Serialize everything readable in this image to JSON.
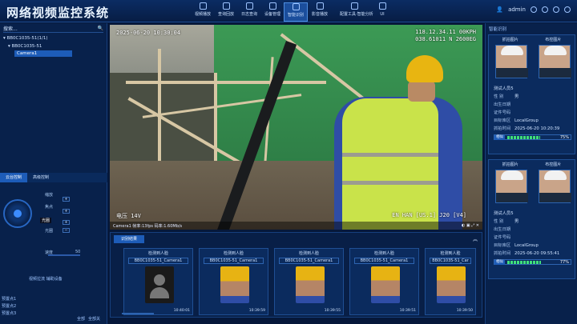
{
  "app": {
    "title": "网络视频监控系统",
    "user": "admin"
  },
  "nav": [
    {
      "label": "视频播放"
    },
    {
      "label": "查询回放"
    },
    {
      "label": "日志查询"
    },
    {
      "label": "设备管理"
    },
    {
      "label": "智能识别",
      "active": true
    },
    {
      "label": "影音播放"
    },
    {
      "label": "配置工具·智能分析"
    },
    {
      "label": "UI"
    }
  ],
  "left": {
    "search_placeholder": "搜索...",
    "tree": [
      {
        "label": "BB0C1035-51(1/1)"
      },
      {
        "label": "BB0C1035-51"
      },
      {
        "label": "Camera1",
        "selected": true
      }
    ],
    "tabs": [
      "云台控制",
      "高级控制"
    ],
    "ptz": {
      "zoom": "缩放",
      "focus": "焦点",
      "iris": "光圈",
      "speed_label": "速度",
      "speed_value": "50",
      "tooltip": "光圈"
    },
    "hint": "视频拉流   辅助设备",
    "presets": [
      "预置点1",
      "预置点2",
      "预置点3"
    ],
    "footer_btns": [
      "全部",
      "全部关"
    ]
  },
  "video": {
    "timestamp": "2025-06-20 10:30:04",
    "osd_tr1": "118.12.34.11 00KPH",
    "osd_tr2": "038.61011 N 2600EG",
    "osd_bl": "电压 14V",
    "osd_br": "EN HAN [US.1] J20 [V4]",
    "status_left": "Camera1  帧率:13fps 码率:1.60Mb/s",
    "status_right": "◐ ▣ ⤢ ✕"
  },
  "bottom": {
    "tab": "识别结果",
    "cards": [
      {
        "header": "检测到人脸",
        "camera": "BB0C1035-51_Camera1",
        "time": "10:40:01",
        "type": "placeholder"
      },
      {
        "header": "检测到人脸",
        "camera": "BB0C1035-51_Camera1",
        "time": "10:39:59",
        "type": "helmet"
      },
      {
        "header": "检测到人脸",
        "camera": "BB0C1035-51_Camera1",
        "time": "10:39:55",
        "type": "helmet"
      },
      {
        "header": "检测到人脸",
        "camera": "BB0C1035-51_Camera1",
        "time": "10:39:51",
        "type": "helmet"
      },
      {
        "header": "检测到人脸",
        "camera": "BB0C1035-51_Car",
        "time": "10:39:50",
        "type": "helmet"
      }
    ]
  },
  "right": {
    "header": "智能识别",
    "records": [
      {
        "snap_label": "抓拍图片",
        "lib_label": "布控图片",
        "name_k": "测试人员5",
        "gender_k": "性    别",
        "gender_v": "男",
        "birth_k": "出生日期",
        "cert_k": "证件号码",
        "lib_k": "目标库区",
        "lib_v": "LocalGroup",
        "time_k": "抓拍时间",
        "time_v": "2025-06-20 10:20:39",
        "sim_tag": "相似",
        "similarity": 75,
        "sim_text": "75%"
      },
      {
        "snap_label": "抓拍图片",
        "lib_label": "布控图片",
        "name_k": "测试人员5",
        "gender_k": "性    别",
        "gender_v": "男",
        "birth_k": "出生日期",
        "cert_k": "证件号码",
        "lib_k": "目标库区",
        "lib_v": "LocalGroup",
        "time_k": "抓拍时间",
        "time_v": "2025-06-20 09:55:41",
        "sim_tag": "相似",
        "similarity": 77,
        "sim_text": "77%"
      }
    ]
  },
  "colors": {
    "accent": "#1d5cb8",
    "bg": "#06183a",
    "vest": "#c9e34a",
    "helmet": "#e8b511"
  }
}
